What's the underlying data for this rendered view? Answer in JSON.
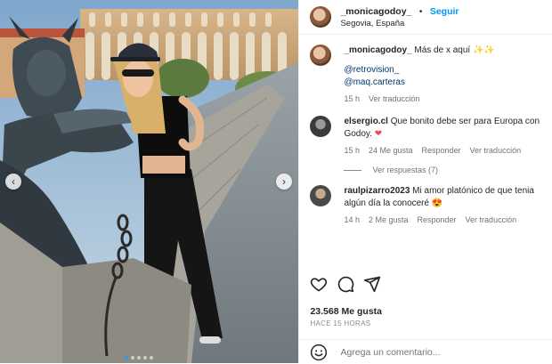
{
  "post": {
    "username": "_monicagodoy_",
    "separator": "•",
    "follow_label": "Seguir",
    "location": "Segovia, España"
  },
  "caption": {
    "username": "_monicagodoy_",
    "text": "Más de x aquí ✨✨",
    "links": [
      "@retrovision_",
      "@maq.carteras"
    ],
    "time": "15 h",
    "translate": "Ver traducción"
  },
  "comments": [
    {
      "username": "elsergio.cl",
      "text": "Que bonito debe ser para Europa con Godoy.",
      "emoji": "❤",
      "time": "15 h",
      "likes": "24 Me gusta",
      "reply": "Responder",
      "translate": "Ver traducción",
      "view_replies": "Ver respuestas (7)"
    },
    {
      "username": "raulpizarro2023",
      "text": "Mi amor platónico de que tenia algún día la conoceré",
      "emoji": "😍",
      "time": "14 h",
      "likes": "2 Me gusta",
      "reply": "Responder",
      "translate": "Ver traducción"
    }
  ],
  "stats": {
    "likes": "23.568 Me gusta",
    "time_ago": "HACE 15 HORAS"
  },
  "compose": {
    "placeholder": "Agrega un comentario..."
  },
  "icons": {
    "like": "heart-outline-icon",
    "comment": "comment-bubble-icon",
    "share": "paper-plane-icon",
    "emoji": "smiley-face-icon",
    "prev": "chevron-left-icon",
    "next": "chevron-right-icon"
  },
  "colors": {
    "accent": "#0095f6",
    "link": "#00376b",
    "muted": "#737373"
  }
}
